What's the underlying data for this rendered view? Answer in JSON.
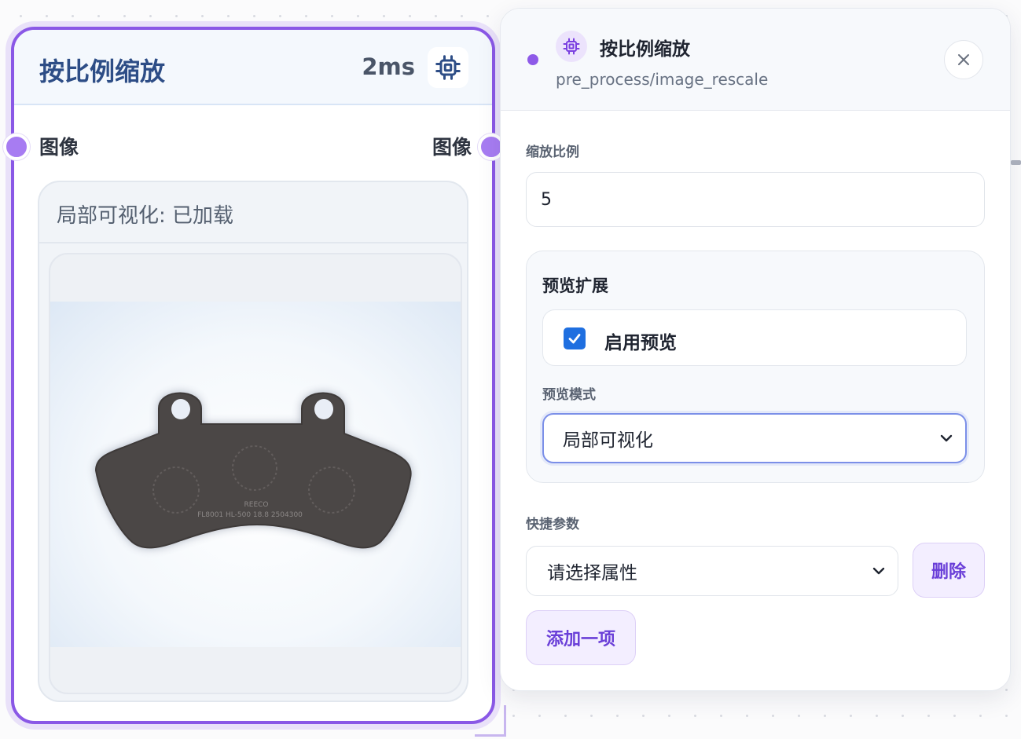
{
  "node": {
    "title": "按比例缩放",
    "time": "2ms",
    "chip_icon": "cpu-chip-icon",
    "input_port_label": "图像",
    "output_port_label": "图像",
    "preview_status": "局部可视化: 已加载",
    "preview_image": {
      "subject": "brake pad",
      "part_text_line1": "REECO",
      "part_text_line2": "FL8001 HL-500 18.8 2504300"
    }
  },
  "panel": {
    "title": "按比例缩放",
    "path": "pre_process/image_rescale",
    "close_icon": "close-icon",
    "scale_label": "缩放比例",
    "scale_value": "5",
    "preview_extension": {
      "title": "预览扩展",
      "enable_label": "启用预览",
      "enable_checked": true,
      "mode_label": "预览模式",
      "mode_value": "局部可视化"
    },
    "quick_params": {
      "label": "快捷参数",
      "select_placeholder": "请选择属性",
      "delete_label": "删除",
      "add_label": "添加一项"
    }
  },
  "colors": {
    "accent": "#8a58e6",
    "title_blue": "#2d4d86",
    "checkbox_blue": "#1f6fe0"
  }
}
